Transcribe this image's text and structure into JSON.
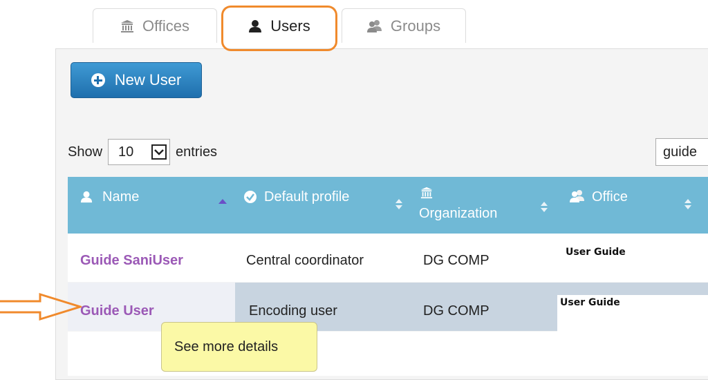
{
  "tabs": {
    "offices": "Offices",
    "users": "Users",
    "groups": "Groups"
  },
  "toolbar": {
    "new_user_label": "New User"
  },
  "length": {
    "show_label": "Show",
    "selected": "10",
    "entries_label": "entries"
  },
  "search": {
    "value": "guide"
  },
  "table": {
    "columns": {
      "name": "Name",
      "default_profile": "Default profile",
      "organization": "Organization",
      "office": "Office"
    },
    "rows": [
      {
        "name": "Guide SaniUser",
        "profile": "Central coordinator",
        "organization": "DG COMP",
        "office": "User Guide"
      },
      {
        "name": "Guide User",
        "profile": "Encoding user",
        "organization": "DG COMP",
        "office": "User Guide"
      }
    ]
  },
  "tooltip": {
    "text": "See more details"
  },
  "colors": {
    "accent_orange": "#f08a2c",
    "header_blue": "#70b9d6",
    "link_purple": "#9b59b6",
    "button_blue": "#2a80c0"
  },
  "icons": [
    "bank-icon",
    "user-icon",
    "users-icon",
    "check-circle-icon",
    "plus-circle-icon",
    "arrow-right-icon"
  ]
}
